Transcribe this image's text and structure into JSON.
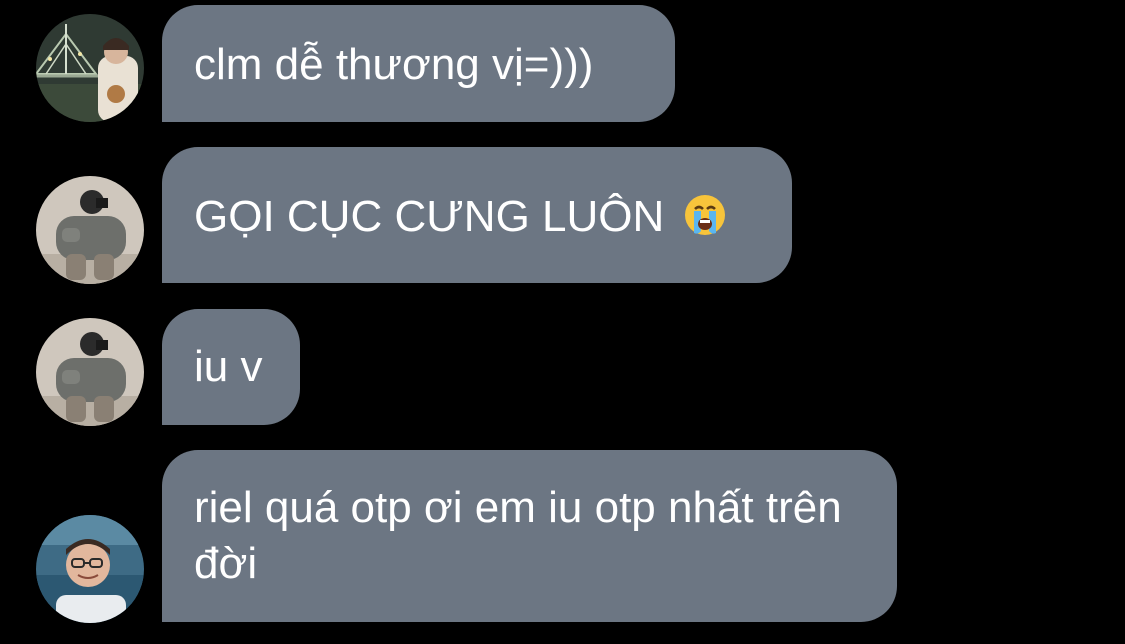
{
  "colors": {
    "background": "#000000",
    "bubble": "#6c7683",
    "text": "#ffffff"
  },
  "messages": [
    {
      "avatar": "avatar-bridge-photo",
      "text": "clm dễ thương vị=)))"
    },
    {
      "avatar": "avatar-puffer-jacket-photo",
      "text": "GỌI CỤC CƯNG LUÔN",
      "emoji": "loudly-crying-face-emoji"
    },
    {
      "avatar": "avatar-puffer-jacket-photo",
      "text": "iu v"
    },
    {
      "avatar": "avatar-glasses-photo",
      "text": "riel quá otp ơi em iu otp nhất trên đời"
    }
  ]
}
